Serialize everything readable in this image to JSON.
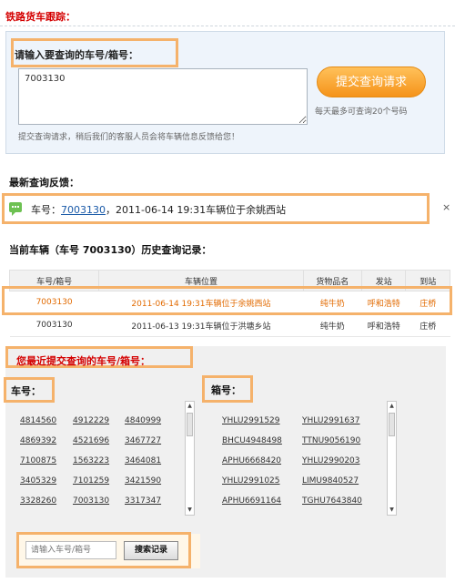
{
  "page_title": "铁路货车跟踪：",
  "query": {
    "label": "请输入要查询的车号/箱号：",
    "textarea_value": "7003130",
    "submit_label": "提交查询请求",
    "quota_text": "每天最多可查询20个号码",
    "hint": "提交查询请求，稍后我们的客服人员会将车辆信息反馈给您！"
  },
  "latest_feedback": {
    "title": "最新查询反馈：",
    "prefix": "车号：",
    "car_no": "7003130",
    "suffix": "，2011-06-14 19:31车辆位于余姚西站",
    "close_symbol": "×"
  },
  "history": {
    "title": "当前车辆（车号 7003130）历史查询记录：",
    "columns": [
      "车号/箱号",
      "车辆位置",
      "货物品名",
      "发站",
      "到站"
    ],
    "rows": [
      [
        "7003130",
        "2011-06-14 19:31车辆位于余姚西站",
        "纯牛奶",
        "呼和浩特",
        "庄桥"
      ],
      [
        "7003130",
        "2011-06-13 19:31车辆位于洪塘乡站",
        "纯牛奶",
        "呼和浩特",
        "庄桥"
      ]
    ]
  },
  "recent": {
    "title": "您最近提交查询的车号/箱号：",
    "car_title": "车号：",
    "box_title": "箱号：",
    "car_numbers": [
      [
        "4814560",
        "4912229",
        "4840999"
      ],
      [
        "4869392",
        "4521696",
        "3467727"
      ],
      [
        "7100875",
        "1563223",
        "3464081"
      ],
      [
        "3405329",
        "7101259",
        "3421590"
      ],
      [
        "3328260",
        "7003130",
        "3317347"
      ]
    ],
    "box_numbers": [
      [
        "YHLU2991529",
        "YHLU2991637"
      ],
      [
        "BHCU4948498",
        "TTNU9056190"
      ],
      [
        "APHU6668420",
        "YHLU2990203"
      ],
      [
        "YHLU2991025",
        "LIMU9840527"
      ],
      [
        "APHU6691164",
        "TGHU7643840"
      ]
    ],
    "search_placeholder": "请输入车号/箱号",
    "search_button": "搜索记录"
  },
  "colors": {
    "title_red": "#d40000",
    "highlight_orange": "#f5b26b",
    "button_orange": "#f5931a",
    "link_blue": "#1a5aa8",
    "active_row": "#e26a00"
  }
}
